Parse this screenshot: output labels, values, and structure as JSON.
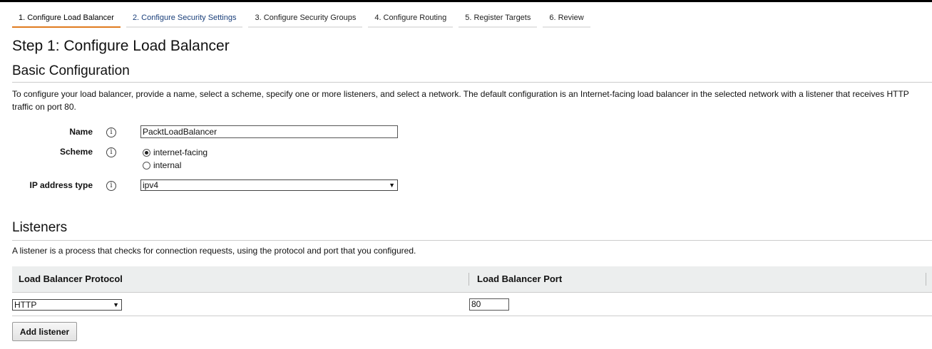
{
  "tabs": [
    {
      "label": "1. Configure Load Balancer"
    },
    {
      "label": "2. Configure Security Settings"
    },
    {
      "label": "3. Configure Security Groups"
    },
    {
      "label": "4. Configure Routing"
    },
    {
      "label": "5. Register Targets"
    },
    {
      "label": "6. Review"
    }
  ],
  "page_title": "Step 1: Configure Load Balancer",
  "basic": {
    "heading": "Basic Configuration",
    "description": "To configure your load balancer, provide a name, select a scheme, specify one or more listeners, and select a network. The default configuration is an Internet-facing load balancer in the selected network with a listener that receives HTTP traffic on port 80.",
    "name_label": "Name",
    "name_value": "PacktLoadBalancer",
    "scheme_label": "Scheme",
    "scheme_options": [
      "internet-facing",
      "internal"
    ],
    "ip_label": "IP address type",
    "ip_value": "ipv4"
  },
  "listeners": {
    "heading": "Listeners",
    "description": "A listener is a process that checks for connection requests, using the protocol and port that you configured.",
    "col_protocol": "Load Balancer Protocol",
    "col_port": "Load Balancer Port",
    "protocol_value": "HTTP",
    "port_value": "80",
    "add_button": "Add listener"
  },
  "colors": {
    "active_tab": "#e07b1f",
    "header_bg": "#eceeee"
  },
  "icons": {
    "info": "info-icon",
    "dropdown": "chevron-down-icon"
  }
}
